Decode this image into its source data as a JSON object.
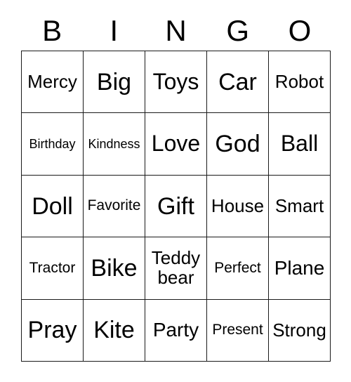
{
  "card": {
    "title": "BINGO",
    "header_letters": [
      "B",
      "I",
      "N",
      "G",
      "O"
    ],
    "border_color": "#1a1a1a",
    "background_color": "#ffffff",
    "text_color": "#000000",
    "columns": 5,
    "rows": 5,
    "cells": [
      [
        {
          "text": "Mercy",
          "size": "fs-sm"
        },
        {
          "text": "Big",
          "size": "fs-xl"
        },
        {
          "text": "Toys",
          "size": "fs-lg"
        },
        {
          "text": "Car",
          "size": "fs-xl"
        },
        {
          "text": "Robot",
          "size": "fs-sm"
        }
      ],
      [
        {
          "text": "Birthday",
          "size": "fs-xxs"
        },
        {
          "text": "Kindness",
          "size": "fs-xxs"
        },
        {
          "text": "Love",
          "size": "fs-lg"
        },
        {
          "text": "God",
          "size": "fs-xl"
        },
        {
          "text": "Ball",
          "size": "fs-lg"
        }
      ],
      [
        {
          "text": "Doll",
          "size": "fs-xl"
        },
        {
          "text": "Favorite",
          "size": "fs-xs"
        },
        {
          "text": "Gift",
          "size": "fs-xl"
        },
        {
          "text": "House",
          "size": "fs-sm"
        },
        {
          "text": "Smart",
          "size": "fs-sm"
        }
      ],
      [
        {
          "text": "Tractor",
          "size": "fs-xs"
        },
        {
          "text": "Bike",
          "size": "fs-xl"
        },
        {
          "text": "Teddy bear",
          "size": "fs-wrap"
        },
        {
          "text": "Perfect",
          "size": "fs-xs"
        },
        {
          "text": "Plane",
          "size": "fs-md"
        }
      ],
      [
        {
          "text": "Pray",
          "size": "fs-xl"
        },
        {
          "text": "Kite",
          "size": "fs-xl"
        },
        {
          "text": "Party",
          "size": "fs-md"
        },
        {
          "text": "Present",
          "size": "fs-xs"
        },
        {
          "text": "Strong",
          "size": "fs-sm"
        }
      ]
    ]
  }
}
